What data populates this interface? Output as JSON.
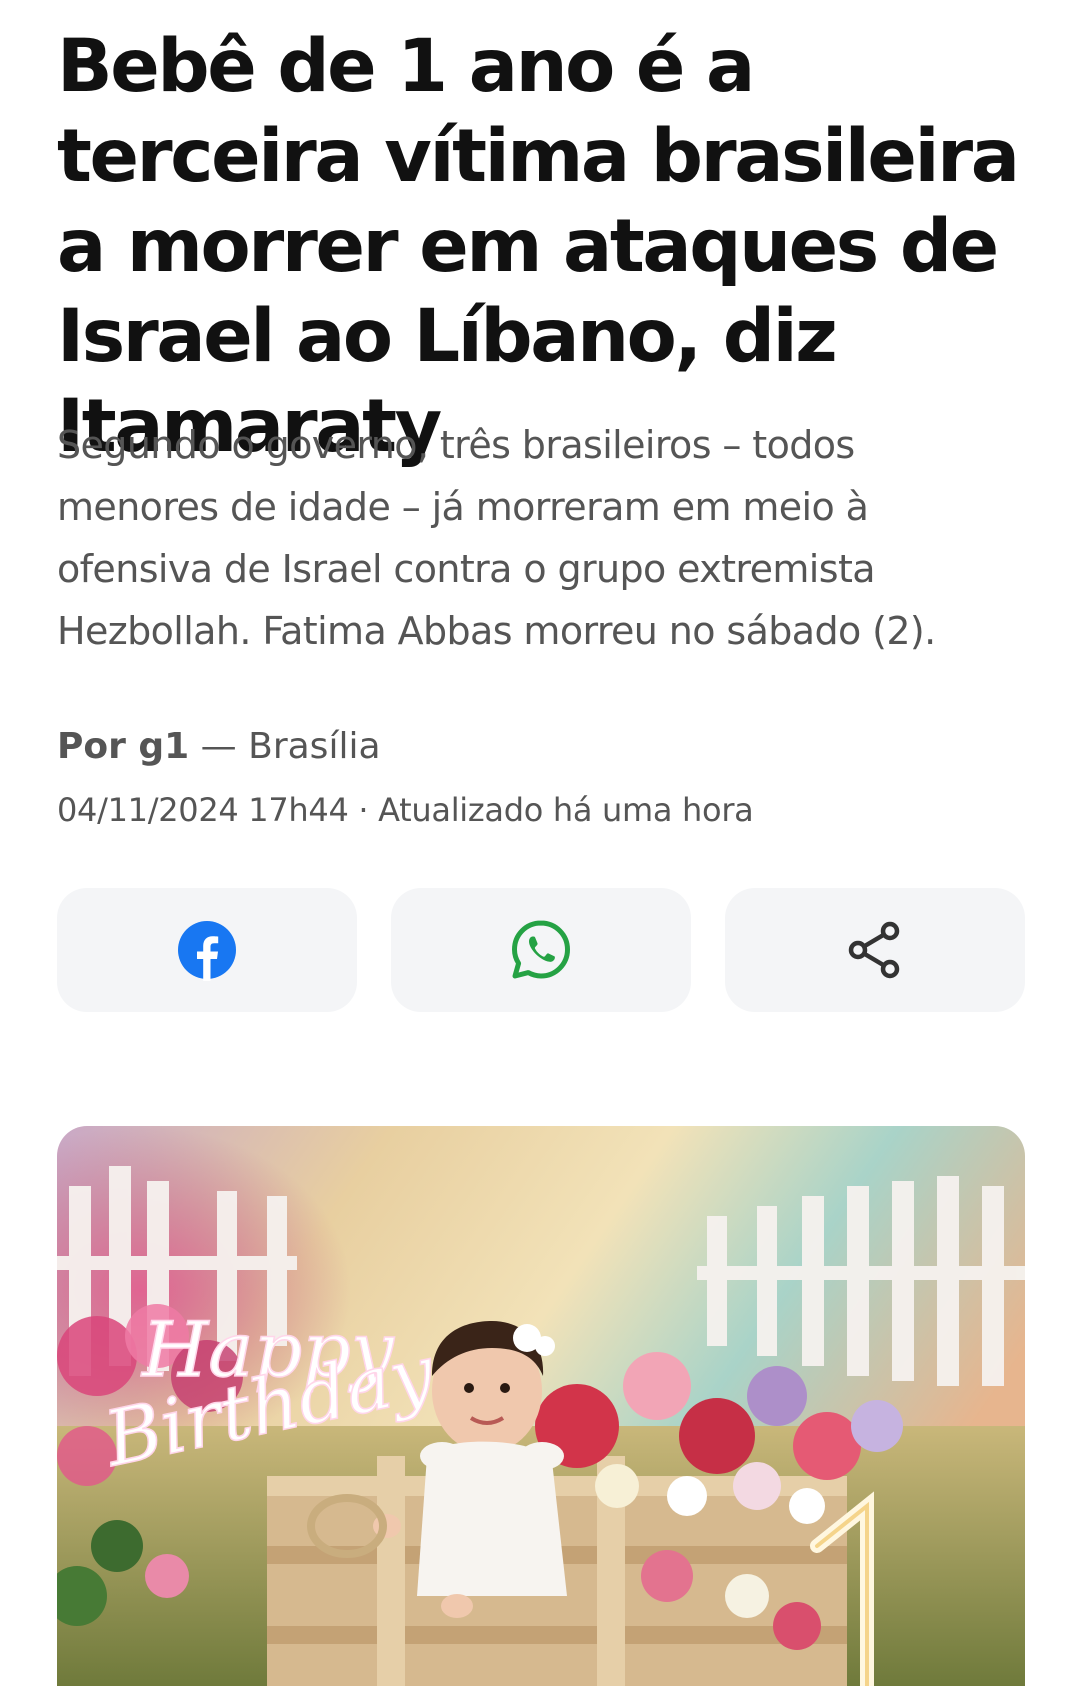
{
  "article": {
    "headline": "Bebê de 1 ano é a terceira vítima brasileira a morrer em ataques de Israel ao Líbano, diz Itamaraty",
    "subtitle": "Segundo o governo, três brasileiros – todos menores de idade – já morreram em meio à ofensiva de Israel contra o grupo extremista Hezbollah. Fatima Abbas morreu no sábado (2).",
    "byline": {
      "author": "Por g1",
      "separator": " — ",
      "location": "Brasília"
    },
    "dateline": "04/11/2024 17h44 · Atualizado há uma hora"
  },
  "share": {
    "buttons": [
      {
        "name": "facebook",
        "icon": "facebook-icon",
        "color": "#1877f2"
      },
      {
        "name": "whatsapp",
        "icon": "whatsapp-icon",
        "color": "#25a244"
      },
      {
        "name": "share",
        "icon": "share-icon",
        "color": "#333333"
      }
    ]
  },
  "hero_image": {
    "neon_line1": "Happy",
    "neon_line2": "Birthday"
  },
  "colors": {
    "text_primary": "#111111",
    "text_secondary": "#555555",
    "share_bg": "#f4f5f7",
    "facebook": "#1877f2",
    "whatsapp": "#25a244"
  }
}
